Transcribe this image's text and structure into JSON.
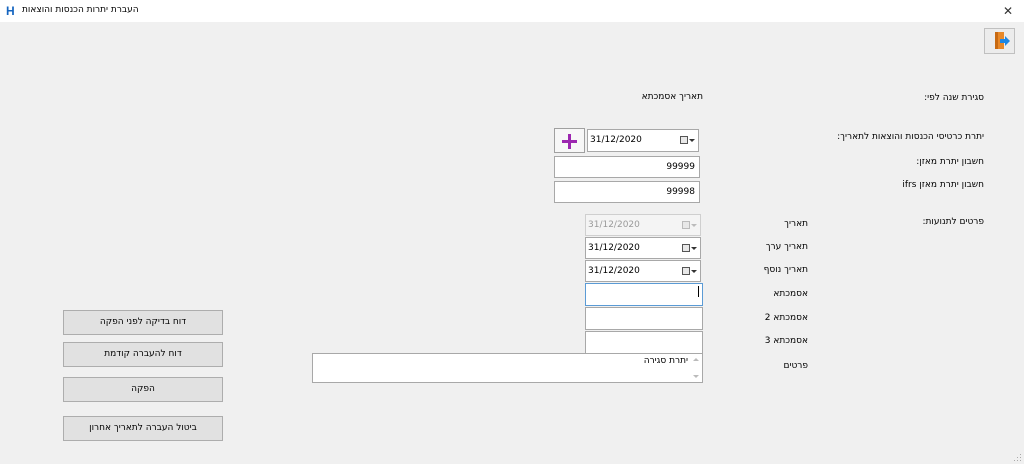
{
  "window": {
    "title": "העברת יתרות הכנסות והוצאות",
    "app_icon": "H",
    "close_glyph": "✕"
  },
  "header": {
    "closing_year_by_label": "סגירת שנה לפי:",
    "reference_date_label": "תאריך אסמכתא"
  },
  "transfer": {
    "label": "יתרת כרטיסי הכנסות והוצאות לתאריך:",
    "date_value": "31/12/2020",
    "balance_account_label": "חשבון יתרת מאזן:",
    "balance_account_value": "99999",
    "ifrs_account_label": "חשבון יתרת מאזן ifrs",
    "ifrs_account_value": "99998"
  },
  "entry_details": {
    "section_label": "פרטים לתנועות:",
    "date_label": "תאריך",
    "date_value": "31/12/2020",
    "value_date_label": "תאריך ערך",
    "value_date_value": "31/12/2020",
    "extra_date_label": "תאריך נוסף",
    "extra_date_value": "31/12/2020",
    "reference_label": "אסמכתא",
    "reference_value": "",
    "reference2_label": "אסמכתא 2",
    "reference2_value": "",
    "reference3_label": "אסמכתא 3",
    "reference3_value": "",
    "details_label": "פרטים",
    "details_value": "יתרת סגירה"
  },
  "buttons": {
    "pre_run_check_report": "דוח בדיקה לפני הפקה",
    "previous_transfer_report": "דוח להעברה קודמת",
    "produce": "הפקה",
    "cancel_last_transfer": "ביטול העברה לתאריך אחרון"
  },
  "icons": {
    "exit": "exit-door-icon",
    "add": "plus-icon",
    "calendar": "calendar-icon",
    "dropdown": "chevron-down-icon"
  },
  "colors": {
    "accent_plus": "#9c27b0",
    "exit_door": "#e8892a",
    "exit_arrow": "#1e88e5",
    "focus_border": "#5b9bd5"
  }
}
